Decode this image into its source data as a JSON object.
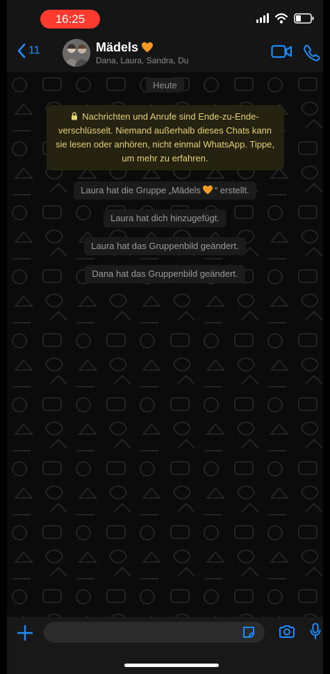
{
  "status_bar": {
    "time": "16:25",
    "time_pill_color": "#ff3b30"
  },
  "header": {
    "back_count": "11",
    "group_name": "Mädels",
    "group_emoji": "orange-heart",
    "members": "Dana, Laura, Sandra, Du",
    "accent_color": "#1d8cff"
  },
  "chat": {
    "date_label": "Heute",
    "encryption_notice": "Nachrichten und Anrufe sind Ende-zu-Ende-verschlüsselt. Niemand außerhalb dieses Chats kann sie lesen oder anhören, nicht einmal WhatsApp. Tippe, um mehr zu erfahren.",
    "system_messages": {
      "created_before": "Laura hat die Gruppe „Mädels",
      "created_after": "“ erstellt.",
      "added": "Laura hat dich hinzugefügt.",
      "laura_photo": "Laura hat das Gruppenbild geändert.",
      "dana_photo": "Dana hat das Gruppenbild geändert."
    }
  },
  "composer": {
    "input_value": "",
    "input_placeholder": ""
  },
  "icons": [
    "back-chevron-icon",
    "video-call-icon",
    "phone-icon",
    "plus-icon",
    "sticker-icon",
    "camera-icon",
    "microphone-icon",
    "lock-icon",
    "orange-heart-icon",
    "signal-icon",
    "wifi-icon",
    "battery-icon"
  ]
}
